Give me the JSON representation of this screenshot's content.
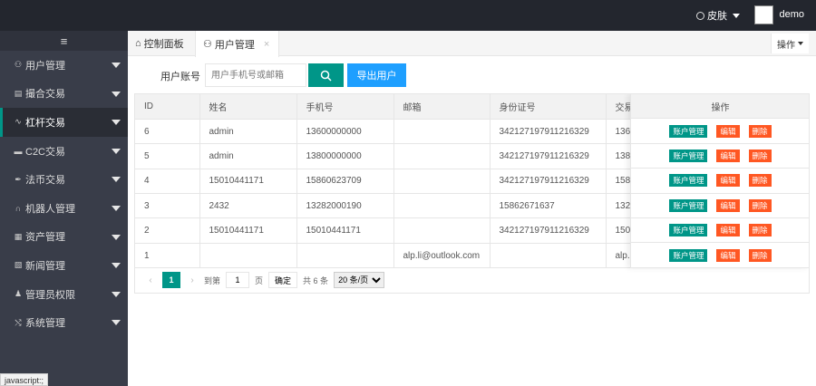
{
  "topbar": {
    "skin_label": "皮肤",
    "username": "demo"
  },
  "sidebar": {
    "fold_icon": "≡",
    "items": [
      {
        "label": "用户管理",
        "icon": "user-icon",
        "glyph": "⚇"
      },
      {
        "label": "撮合交易",
        "icon": "grid-icon",
        "glyph": "▤"
      },
      {
        "label": "杠杆交易",
        "icon": "pulse-icon",
        "glyph": "∿"
      },
      {
        "label": "C2C交易",
        "icon": "chat-icon",
        "glyph": "▬"
      },
      {
        "label": "法币交易",
        "icon": "leaf-icon",
        "glyph": "✒"
      },
      {
        "label": "机器人管理",
        "icon": "headset-icon",
        "glyph": "∩"
      },
      {
        "label": "资产管理",
        "icon": "apps-icon",
        "glyph": "▦"
      },
      {
        "label": "新闻管理",
        "icon": "doc-icon",
        "glyph": "▧"
      },
      {
        "label": "管理员权限",
        "icon": "users-icon",
        "glyph": "♟"
      },
      {
        "label": "系统管理",
        "icon": "shuffle-icon",
        "glyph": "⤭"
      }
    ],
    "active_index": 2
  },
  "status_text": "javascript:;",
  "tabs": [
    {
      "label": "控制面板",
      "icon": "home-icon"
    },
    {
      "label": "用户管理",
      "icon": "user-icon"
    }
  ],
  "tab_close": "×",
  "ops_dropdown": "操作",
  "search": {
    "label": "用户账号",
    "placeholder": "用户手机号或邮箱",
    "export_label": "导出用户"
  },
  "table": {
    "columns": [
      "ID",
      "姓名",
      "手机号",
      "邮箱",
      "身份证号",
      "交易"
    ],
    "rows": [
      [
        "6",
        "admin",
        "13600000000",
        "",
        "342127197911216329",
        "136"
      ],
      [
        "5",
        "admin",
        "13800000000",
        "",
        "342127197911216329",
        "138"
      ],
      [
        "4",
        "15010441171",
        "15860623709",
        "",
        "342127197911216329",
        "158"
      ],
      [
        "3",
        "2432",
        "13282000190",
        "",
        "15862671637",
        "132"
      ],
      [
        "2",
        "15010441171",
        "15010441171",
        "",
        "342127197911216329",
        "150"
      ],
      [
        "1",
        "",
        "",
        "alp.li@outlook.com",
        "",
        "alp.l"
      ]
    ],
    "ops_header": "操作",
    "actions": [
      "账户管理",
      "编辑",
      "删除"
    ]
  },
  "pager": {
    "prev": "‹",
    "next": "›",
    "current": "1",
    "goto_label": "到第",
    "goto_value": "1",
    "page_unit": "页",
    "confirm": "确定",
    "total": "共 6 条",
    "page_size": "20 条/页"
  }
}
